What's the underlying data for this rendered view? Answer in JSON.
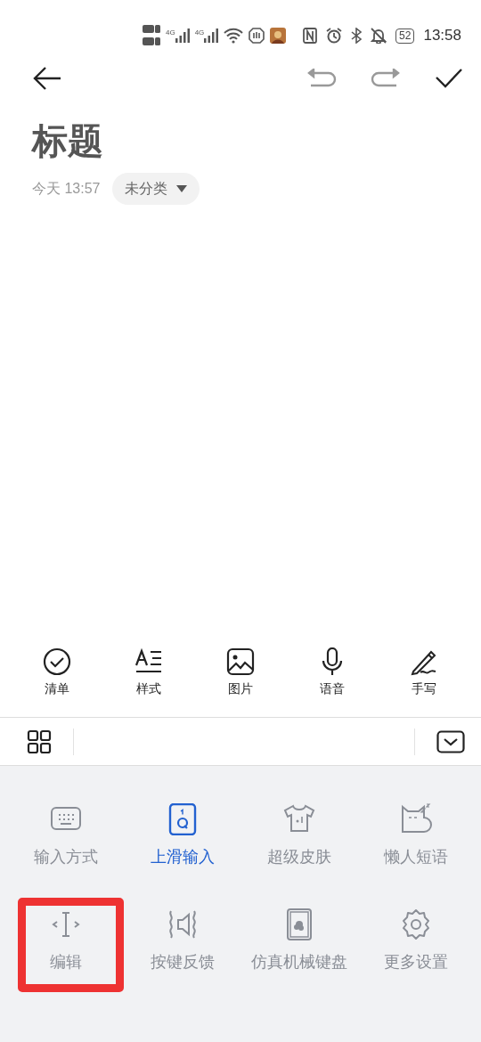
{
  "status_bar": {
    "network": [
      "4G",
      "4G"
    ],
    "battery": "52",
    "time": "13:58"
  },
  "note": {
    "title": "标题",
    "date": "今天 13:57",
    "category": "未分类"
  },
  "edit_toolbar": [
    {
      "kind": "checklist",
      "label": "清单"
    },
    {
      "kind": "style",
      "label": "样式"
    },
    {
      "kind": "image",
      "label": "图片"
    },
    {
      "kind": "voice",
      "label": "语音"
    },
    {
      "kind": "handwrite",
      "label": "手写"
    }
  ],
  "keyboard_menu": {
    "items": [
      {
        "kind": "input-mode",
        "label": "输入方式",
        "on": false,
        "highlighted": false
      },
      {
        "kind": "swipe",
        "label": "上滑输入",
        "on": true,
        "highlighted": false
      },
      {
        "kind": "skin",
        "label": "超级皮肤",
        "on": false,
        "highlighted": false
      },
      {
        "kind": "phrases",
        "label": "懒人短语",
        "on": false,
        "highlighted": false
      },
      {
        "kind": "edit",
        "label": "编辑",
        "on": false,
        "highlighted": true
      },
      {
        "kind": "feedback",
        "label": "按键反馈",
        "on": false,
        "highlighted": false
      },
      {
        "kind": "mechanical",
        "label": "仿真机械键盘",
        "on": false,
        "highlighted": false
      },
      {
        "kind": "settings",
        "label": "更多设置",
        "on": false,
        "highlighted": false
      }
    ]
  }
}
